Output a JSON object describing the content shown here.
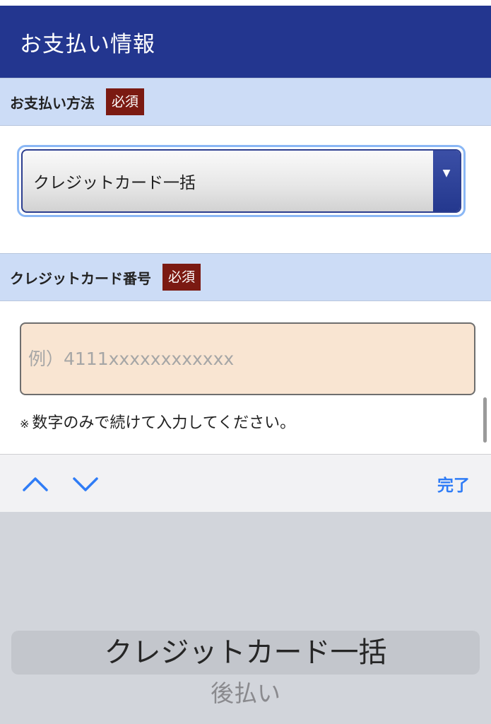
{
  "header": {
    "title": "お支払い情報"
  },
  "payment_method": {
    "label": "お支払い方法",
    "required_badge": "必須",
    "selected_value": "クレジットカード一括",
    "arrow_glyph": "▼"
  },
  "card_number": {
    "label": "クレジットカード番号",
    "required_badge": "必須",
    "placeholder": "例）4111xxxxxxxxxxxx",
    "value": "",
    "note_mark": "※",
    "note": "数字のみで続けて入力してください。"
  },
  "keyboard_toolbar": {
    "prev_icon": "chevron-up-icon",
    "next_icon": "chevron-down-icon",
    "done_label": "完了",
    "accent_color": "#2f7cf6"
  },
  "picker": {
    "selected_option": "クレジットカード一括",
    "options": [
      "クレジットカード一括",
      "後払い"
    ]
  },
  "colors": {
    "header_bg": "#23368f",
    "section_bg": "#ccdcf6",
    "badge_bg": "#7b1a12",
    "input_bg": "#f9e5d2"
  }
}
